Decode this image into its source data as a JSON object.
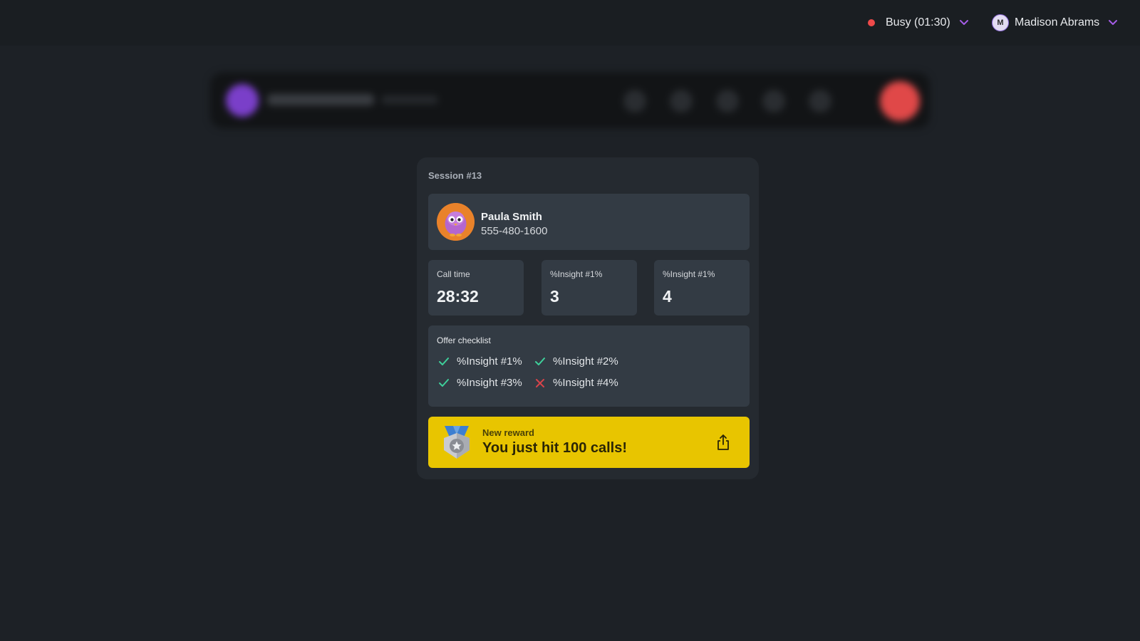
{
  "topbar": {
    "status": {
      "text": "Busy (01:30)",
      "color": "#ef4a4a"
    },
    "user": {
      "initial": "M",
      "name": "Madison Abrams"
    },
    "accent": "#a45ce6"
  },
  "session": {
    "title": "Session #13",
    "contact": {
      "name": "Paula Smith",
      "phone": "555-480-1600"
    },
    "stats": [
      {
        "label": "Call time",
        "value": "28:32"
      },
      {
        "label": "%Insight #1%",
        "value": "3"
      },
      {
        "label": "%Insight #1%",
        "value": "4"
      }
    ],
    "checklist": {
      "title": "Offer checklist",
      "items": [
        {
          "label": "%Insight #1%",
          "done": true
        },
        {
          "label": "%Insight #2%",
          "done": true
        },
        {
          "label": "%Insight #3%",
          "done": true
        },
        {
          "label": "%Insight #4%",
          "done": false
        }
      ],
      "check_color": "#3ecf9a",
      "cross_color": "#d9434a"
    },
    "reward": {
      "label": "New reward",
      "text": "You just hit 100 calls!",
      "color": "#e8c500"
    }
  }
}
